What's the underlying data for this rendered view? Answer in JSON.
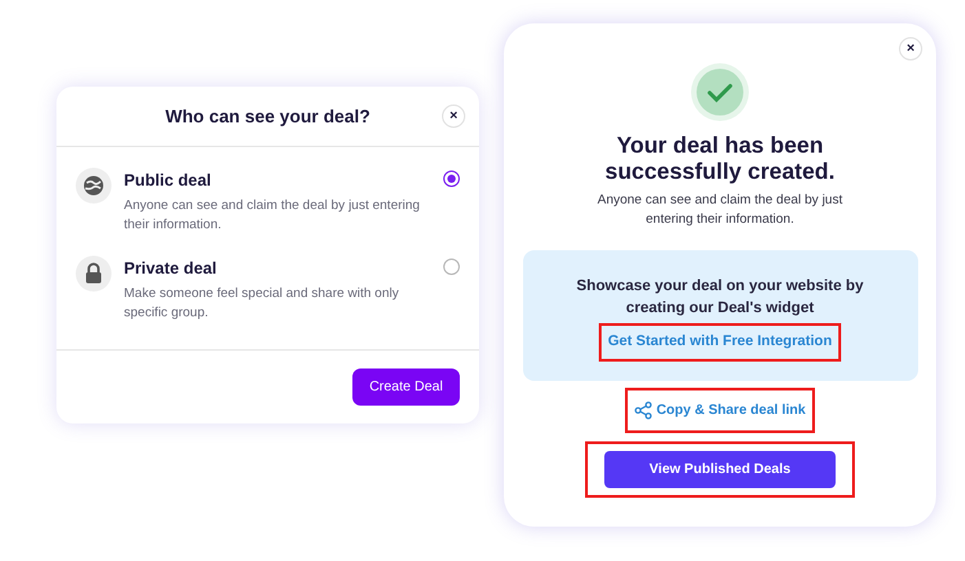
{
  "visibility_dialog": {
    "title": "Who can see your deal?",
    "close": "×",
    "options": [
      {
        "kind": "public",
        "label": "Public deal",
        "description": "Anyone can see and claim the deal by just entering their information.",
        "selected": true
      },
      {
        "kind": "private",
        "label": "Private deal",
        "description": "Make someone feel special and share with only specific group.",
        "selected": false
      }
    ],
    "create_button": "Create Deal"
  },
  "success_dialog": {
    "close": "×",
    "title": "Your deal has been successfully created.",
    "subtitle": "Anyone can see and claim the deal by just entering their information.",
    "promo": {
      "text": "Showcase your deal on your website by creating our Deal's widget",
      "link": "Get Started with Free Integration",
      "highlighted": true
    },
    "share_link": {
      "label": "Copy & Share deal link",
      "highlighted": true
    },
    "view_button": {
      "label": "View Published Deals",
      "highlighted": true
    }
  }
}
